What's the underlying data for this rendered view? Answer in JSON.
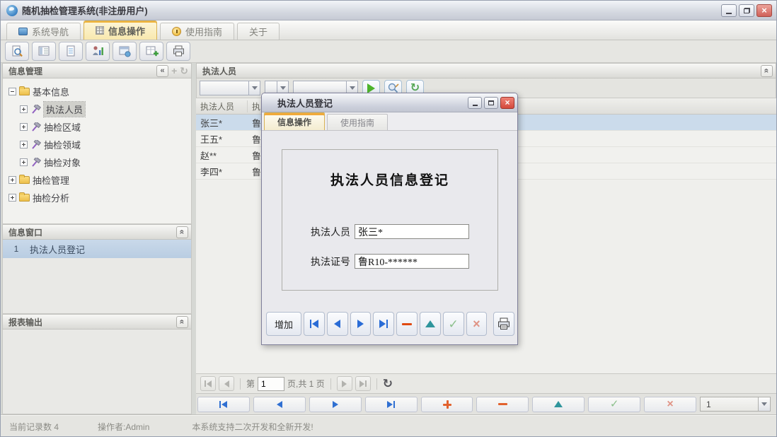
{
  "window": {
    "title": "随机抽检管理系统(非注册用户)"
  },
  "tabs": {
    "nav": "系统导航",
    "info": "信息操作",
    "guide": "使用指南",
    "about": "关于"
  },
  "toolbar": {
    "buttons": [
      "search-document",
      "data-list",
      "new-document",
      "person-report",
      "window-preview",
      "table-add",
      "printer"
    ]
  },
  "sidebar": {
    "info_title": "信息管理",
    "tree": [
      {
        "label": "基本信息"
      },
      {
        "label": "执法人员"
      },
      {
        "label": "抽检区域"
      },
      {
        "label": "抽检领域"
      },
      {
        "label": "抽检对象"
      },
      {
        "label": "抽检管理"
      },
      {
        "label": "抽检分析"
      }
    ],
    "window_title": "信息窗口",
    "window_item": {
      "num": "1",
      "label": "执法人员登记"
    },
    "report_title": "报表输出"
  },
  "main": {
    "title": "执法人员",
    "table": {
      "col1": "执法人员",
      "col2": "执",
      "rows": [
        {
          "c1": "张三*",
          "c2": "鲁"
        },
        {
          "c1": "王五*",
          "c2": "鲁"
        },
        {
          "c1": "赵**",
          "c2": "鲁"
        },
        {
          "c1": "李四*",
          "c2": "鲁"
        }
      ]
    },
    "pager": {
      "prefix": "第",
      "page": "1",
      "suffix": "页,共 1 页"
    }
  },
  "dialog": {
    "title": "执法人员登记",
    "tab_info": "信息操作",
    "tab_guide": "使用指南",
    "heading": "执法人员信息登记",
    "field1": {
      "label": "执法人员",
      "value": "张三*"
    },
    "field2": {
      "label": "执法证号",
      "value": "鲁R10-******"
    },
    "add_button": "增加"
  },
  "bottom": {
    "page_select": "1"
  },
  "status": {
    "records": "当前记录数 4",
    "operator": "操作者:Admin",
    "message": "本系统支持二次开发和全新开发!"
  },
  "colors": {
    "active_tab_gold": "#eeb33c",
    "selection_blue": "#cbdbeb",
    "nav_blue": "#2f6fd2",
    "ok_green": "#8cc08c",
    "warn_orange": "#e2622e",
    "teal": "#2f959c",
    "close_red": "#d4493c"
  }
}
